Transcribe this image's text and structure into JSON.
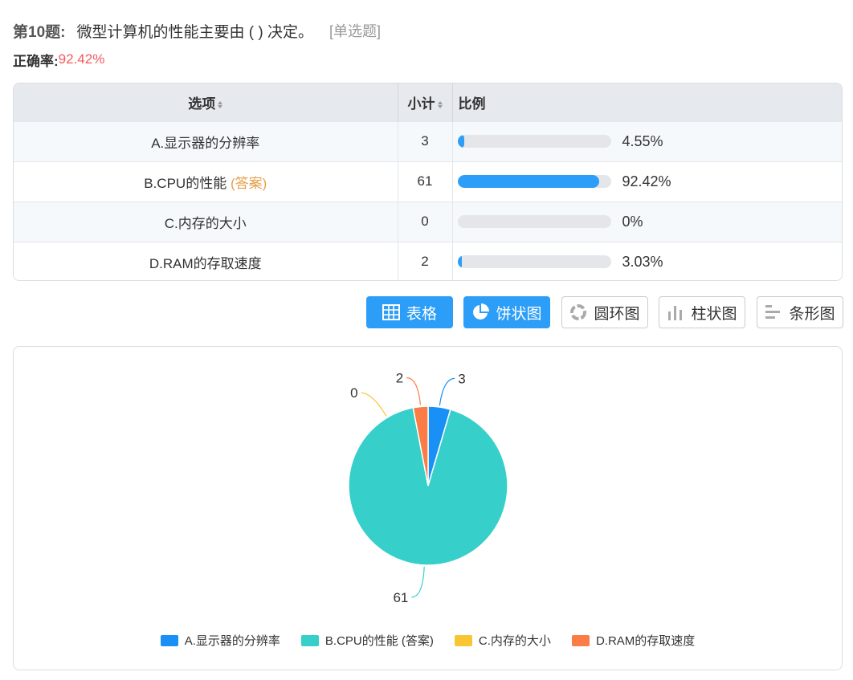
{
  "question": {
    "number": "第10题:",
    "text": "微型计算机的性能主要由 ( ) 决定。",
    "type": "[单选题]"
  },
  "accuracy": {
    "label": "正确率:",
    "value": "92.42%"
  },
  "table": {
    "headers": {
      "option": "选项",
      "count": "小计",
      "ratio": "比例"
    },
    "rows": [
      {
        "label": "A.显示器的分辨率",
        "answer_tag": "",
        "count": "3",
        "percent": "4.55%",
        "fill": 0.0455
      },
      {
        "label": "B.CPU的性能",
        "answer_tag": "(答案)",
        "count": "61",
        "percent": "92.42%",
        "fill": 0.9242
      },
      {
        "label": "C.内存的大小",
        "answer_tag": "",
        "count": "0",
        "percent": "0%",
        "fill": 0
      },
      {
        "label": "D.RAM的存取速度",
        "answer_tag": "",
        "count": "2",
        "percent": "3.03%",
        "fill": 0.0303
      }
    ]
  },
  "view_buttons": [
    {
      "label": "表格",
      "icon": "table-icon",
      "active": true
    },
    {
      "label": "饼状图",
      "icon": "pie-chart-icon",
      "active": true
    },
    {
      "label": "圆环图",
      "icon": "donut-chart-icon",
      "active": false
    },
    {
      "label": "柱状图",
      "icon": "bar-chart-icon",
      "active": false
    },
    {
      "label": "条形图",
      "icon": "horizontal-bar-icon",
      "active": false
    }
  ],
  "colors": {
    "accent": "#2d9ef7",
    "rate": "#f25a5a",
    "answer": "#e5a04a"
  },
  "chart_data": {
    "type": "pie",
    "categories": [
      "A.显示器的分辨率",
      "B.CPU的性能 (答案)",
      "C.内存的大小",
      "D.RAM的存取速度"
    ],
    "values": [
      3,
      61,
      0,
      2
    ],
    "colors": [
      "#1890f5",
      "#36cfc9",
      "#fac533",
      "#fb7c45"
    ],
    "data_labels": [
      "3",
      "61",
      "0",
      "2"
    ],
    "legend_position": "bottom"
  }
}
